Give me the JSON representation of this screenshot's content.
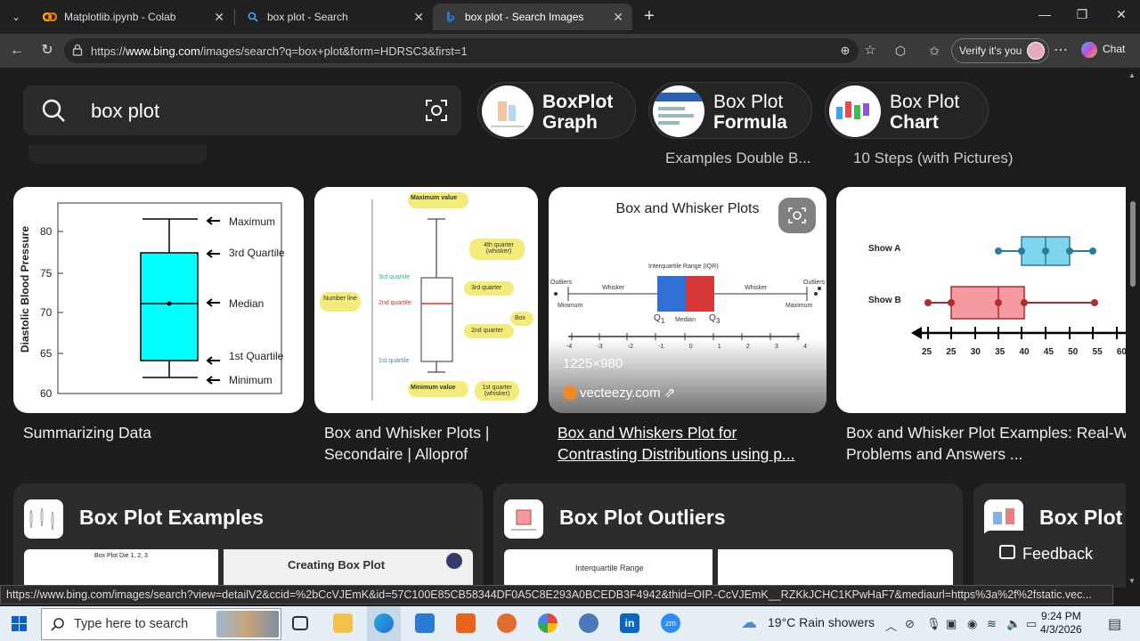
{
  "tabs": [
    {
      "title": "Matplotlib.ipynb - Colab",
      "favicon": "colab-icon"
    },
    {
      "title": "box plot - Search",
      "favicon": "bing-search-icon"
    },
    {
      "title": "box plot - Search Images",
      "favicon": "bing-icon",
      "active": true
    }
  ],
  "address": {
    "prefix": "https://",
    "host": "www.bing.com",
    "path": "/images/search?q=box+plot&form=HDRSC3&first=1"
  },
  "toolbar": {
    "verify_label": "Verify it's you",
    "chat_label": "Chat"
  },
  "search": {
    "query": "box plot"
  },
  "related": [
    {
      "line1": "BoxPlot",
      "line2": "Graph"
    },
    {
      "line1": "Box Plot",
      "line2": "Formula"
    },
    {
      "line1": "Box Plot",
      "line2": "Chart"
    }
  ],
  "partial_captions": [
    "Examples Double B...",
    "10 Steps (with Pictures)"
  ],
  "results": [
    {
      "caption": "Summarizing Data",
      "ylabel": "Diastolic Blood Pressure",
      "ticks": [
        "80",
        "75",
        "70",
        "65",
        "60"
      ],
      "annotations": [
        "Maximum",
        "3rd Quartile",
        "Median",
        "1st Quartile",
        "Minimum"
      ]
    },
    {
      "caption_line1": "Box and Whisker Plots |",
      "caption_line2": "Secondaire | Alloprof",
      "labels": [
        "Maximum value",
        "4th quarter (whisker)",
        "3rd quarter",
        "Box",
        "2nd quarter",
        "Number line",
        "Minimum value",
        "1st quarter (whisker)",
        "3rd quartile",
        "2nd quartile",
        "1st quartile"
      ]
    },
    {
      "caption_line1": "Box and Whiskers Plot for",
      "caption_line2": "Contrasting Distributions using p...",
      "title": "Box and Whisker Plots",
      "labels": [
        "Interquartile Range (IQR)",
        "Whisker",
        "Whisker",
        "Outliers",
        "Outliers",
        "Minimum",
        "Maximum",
        "Median"
      ],
      "dimensions": "1225×980",
      "source": "vecteezy.com",
      "axis": [
        "-4",
        "-3",
        "-2",
        "-1",
        "0",
        "1",
        "2",
        "3",
        "4"
      ]
    },
    {
      "caption_line1": "Box and Whisker Plot Examples: Real-W",
      "caption_line2": "Problems and Answers ...",
      "series": [
        "Show A",
        "Show B"
      ],
      "axis": [
        "25",
        "25",
        "30",
        "35",
        "40",
        "45",
        "50",
        "55",
        "60"
      ]
    }
  ],
  "groups": [
    {
      "title": "Box Plot Examples",
      "thumb1_title": "Box Plot Die 1, 2, 3",
      "thumb2_title": "Creating Box Plot"
    },
    {
      "title": "Box Plot Outliers",
      "thumb1_title": "Interquartile Range"
    },
    {
      "title": "Box Plot"
    }
  ],
  "feedback_label": "Feedback",
  "status_url": "https://www.bing.com/images/search?view=detailV2&ccid=%2bCcVJEmK&id=57C100E85CB58344DF0A5C8E293A0BCEDB3F4942&thid=OIP.-CcVJEmK__RZKkJCHC1KPwHaF7&mediaurl=https%3a%2f%2fstatic.vec...",
  "taskbar": {
    "search_placeholder": "Type here to search",
    "weather": "19°C  Rain showers",
    "time": "9:24 PM",
    "date": "4/3/2026"
  }
}
